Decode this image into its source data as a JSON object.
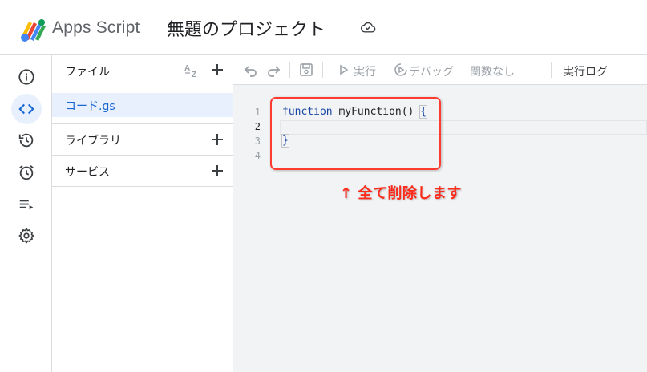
{
  "header": {
    "app_name": "Apps Script",
    "project_title": "無題のプロジェクト",
    "logo_icon": "apps-script-logo",
    "cloud_icon": "cloud-done-icon"
  },
  "rail": {
    "items": [
      {
        "name": "overview",
        "icon": "info-icon",
        "active": false
      },
      {
        "name": "editor",
        "icon": "code-icon",
        "active": true
      },
      {
        "name": "executions",
        "icon": "history-icon",
        "active": false
      },
      {
        "name": "triggers",
        "icon": "alarm-icon",
        "active": false
      },
      {
        "name": "execution-list",
        "icon": "playlist-icon",
        "active": false
      },
      {
        "name": "settings",
        "icon": "gear-icon",
        "active": false
      }
    ]
  },
  "files_panel": {
    "files_label": "ファイル",
    "sort_icon": "sort-az-icon",
    "file_name": "コード.gs",
    "libraries_label": "ライブラリ",
    "services_label": "サービス"
  },
  "toolbar": {
    "run_label": "実行",
    "debug_label": "デバッグ",
    "function_label": "関数なし",
    "log_label": "実行ログ"
  },
  "code": {
    "lines": [
      {
        "num": "1",
        "keyword": "function",
        "rest": " myFunction() ",
        "brace": "{"
      },
      {
        "num": "2"
      },
      {
        "num": "3",
        "brace": "}"
      },
      {
        "num": "4"
      }
    ]
  },
  "annotation": {
    "text": "↑  全て削除します",
    "color": "#ff2a1a"
  },
  "colors": {
    "accent": "#1967d2",
    "active_bg": "#e8f0fe",
    "highlight_box": "#ff3b30"
  }
}
